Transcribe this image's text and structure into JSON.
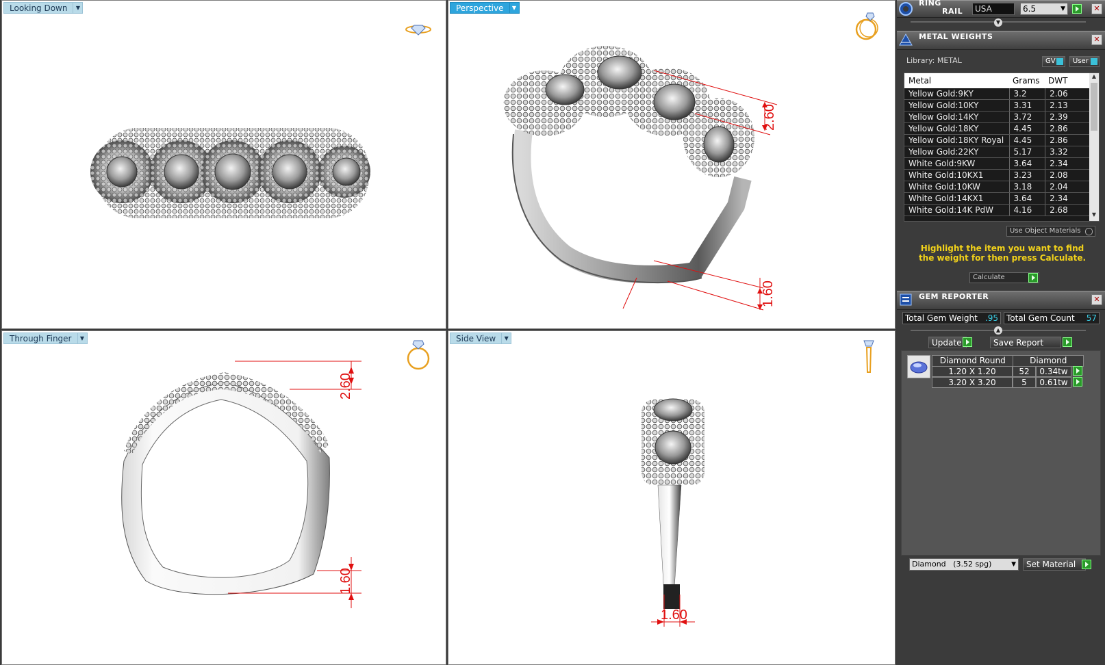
{
  "viewports": {
    "looking_down": {
      "label": "Looking Down"
    },
    "perspective": {
      "label": "Perspective",
      "dim_top": "2.60",
      "dim_bottom": "1.60"
    },
    "through_finger": {
      "label": "Through Finger",
      "dim_top": "2.60",
      "dim_bottom": "1.60"
    },
    "side_view": {
      "label": "Side View",
      "dim_bottom": "1.60"
    }
  },
  "ring_rail": {
    "title_line1": "RING",
    "title_line2": "RAIL",
    "region": "USA",
    "size": "6.5"
  },
  "metal_weights": {
    "title": "METAL WEIGHTS",
    "library_label": "Library: METAL",
    "gv_label": "GV",
    "user_label": "User",
    "columns": [
      "Metal",
      "Grams",
      "DWT"
    ],
    "rows": [
      [
        "Yellow Gold:9KY",
        "3.2",
        "2.06"
      ],
      [
        "Yellow Gold:10KY",
        "3.31",
        "2.13"
      ],
      [
        "Yellow Gold:14KY",
        "3.72",
        "2.39"
      ],
      [
        "Yellow Gold:18KY",
        "4.45",
        "2.86"
      ],
      [
        "Yellow Gold:18KY Royal",
        "4.45",
        "2.86"
      ],
      [
        "Yellow Gold:22KY",
        "5.17",
        "3.32"
      ],
      [
        "White Gold:9KW",
        "3.64",
        "2.34"
      ],
      [
        "White Gold:10KX1",
        "3.23",
        "2.08"
      ],
      [
        "White Gold:10KW",
        "3.18",
        "2.04"
      ],
      [
        "White Gold:14KX1",
        "3.64",
        "2.34"
      ],
      [
        "White Gold:14K PdW",
        "4.16",
        "2.68"
      ]
    ],
    "use_object_materials": "Use Object Materials",
    "instruction": "Highlight the item you want to find the weight for then press Calculate.",
    "calculate": "Calculate"
  },
  "gem_reporter": {
    "title": "GEM REPORTER",
    "total_weight_label": "Total Gem Weight",
    "total_weight": ".95",
    "total_count_label": "Total Gem Count",
    "total_count": "57",
    "update": "Update",
    "save_report": "Save Report",
    "columns": [
      "Diamond Round",
      "Diamond"
    ],
    "rows": [
      {
        "size": "1.20 X 1.20",
        "count": "52",
        "tw": "0.34tw"
      },
      {
        "size": "3.20 X 3.20",
        "count": "5",
        "tw": "0.61tw"
      }
    ],
    "material": "Diamond",
    "material_spg": "(3.52 spg)",
    "set_material": "Set Material"
  },
  "colors": {
    "accent": "#2ea5dd",
    "dimension": "#e01010",
    "instruction": "#f2d21a"
  }
}
